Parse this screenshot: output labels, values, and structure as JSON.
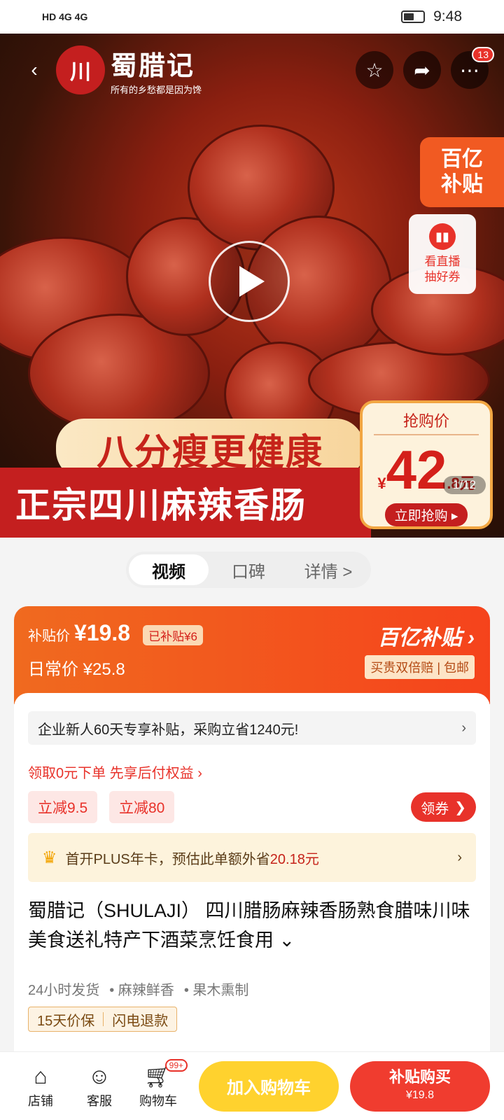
{
  "status_bar": {
    "left_icons": "HD 4G 4G",
    "time": "9:48"
  },
  "hero": {
    "brand_name": "蜀腊记",
    "brand_slogan": "所有的乡愁都是因为馋",
    "notification_count": "13",
    "subsidy_tag_line1": "百亿",
    "subsidy_tag_line2": "补贴",
    "live_line1": "看直播",
    "live_line2": "抽好券",
    "banner_top": "八分瘦更健康",
    "banner_bottom": "正宗四川麻辣香肠",
    "price_label": "抢购价",
    "price_yen": "¥",
    "price_main": "42",
    "price_decimal": ".8元",
    "price_cta": "立即抢购 ▸",
    "image_counter": "1/12"
  },
  "tabs": [
    {
      "label": "视频"
    },
    {
      "label": "口碑"
    },
    {
      "label": "详情 >"
    }
  ],
  "subsidy": {
    "label": "补贴价",
    "price": "¥19.8",
    "subsidized": "已补贴¥6",
    "daily_label": "日常价 ¥25.8",
    "logo": "百亿补贴 ›",
    "guarantee": "买贵双倍赔 | 包邮"
  },
  "info": {
    "enterprise": "企业新人60天专享补贴，采购立省1240元!",
    "pay_later": "领取0元下单 先享后付权益 ›",
    "coupons": [
      "立减9.5",
      "立减80"
    ],
    "get_coupon": "领券",
    "plus_prefix": "首开PLUS年卡，预估此单额外省",
    "plus_amount": "20.18",
    "plus_suffix": "元",
    "title": "蜀腊记（SHULAJI） 四川腊肠麻辣香肠熟食腊味川味美食送礼特产下酒菜烹饪食用 ⌄",
    "features": [
      "24小时发货",
      "• 麻辣鲜香",
      "• 果木熏制"
    ],
    "guarantees": [
      "15天价保",
      "闪电退款"
    ]
  },
  "bottom_bar": {
    "shop": "店铺",
    "service": "客服",
    "cart": "购物车",
    "cart_badge": "99+",
    "add_cart": "加入购物车",
    "buy_now": "补贴购买",
    "buy_now_price": "¥19.8"
  }
}
